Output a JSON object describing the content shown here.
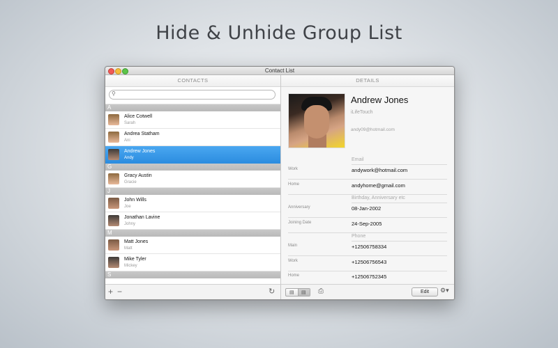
{
  "headline": "Hide & Unhide Group List",
  "window": {
    "title": "Contact List"
  },
  "contacts_panel": {
    "header": "CONTACTS",
    "search": {
      "placeholder": "",
      "value": ""
    },
    "sections": [
      {
        "letter": "A",
        "rows": [
          {
            "name": "Alice Cotwell",
            "sub": "Sarah"
          },
          {
            "name": "Andrea  Statham",
            "sub": "Ani"
          },
          {
            "name": "Andrew Jones",
            "sub": "Andy",
            "selected": true
          }
        ]
      },
      {
        "letter": "G",
        "rows": [
          {
            "name": "Gracy  Austin",
            "sub": "Gracie"
          }
        ]
      },
      {
        "letter": "J",
        "rows": [
          {
            "name": "John  Wills",
            "sub": "Joe"
          },
          {
            "name": "Jonathan  Lavine",
            "sub": "Johny"
          }
        ]
      },
      {
        "letter": "M",
        "rows": [
          {
            "name": "Matt Jones",
            "sub": "Matt"
          },
          {
            "name": "Mike Tyler",
            "sub": "Mickey"
          }
        ]
      },
      {
        "letter": "S",
        "rows": []
      }
    ],
    "bottom": {
      "add": "+",
      "remove": "−",
      "refresh": "↻"
    }
  },
  "details_panel": {
    "header": "DETAILS",
    "name": "Andrew Jones",
    "organization": "iLifeTouch",
    "email_small": "andy09@hotmail.com",
    "groups": {
      "email_header": "Email",
      "work_label": "Work",
      "work_email": "andywork@hotmail.com",
      "home_label": "Home",
      "home_email": "andyhome@gmail.com",
      "dates_header": "Birthday, Anniversary etc",
      "anniversary_label": "Anniversary",
      "anniversary": "08-Jan-2002",
      "joining_label": "Joining Date",
      "joining": "24-Sep-2005",
      "phone_header": "Phone",
      "main_label": "Main",
      "main_phone": "+12506758334",
      "phone_work_label": "Work",
      "work_phone": "+12506756543",
      "phone_home_label": "Home",
      "home_phone": "+12506752345"
    },
    "bottom": {
      "edit": "Edit",
      "gear": "⚙▾",
      "print": "⎙"
    }
  }
}
